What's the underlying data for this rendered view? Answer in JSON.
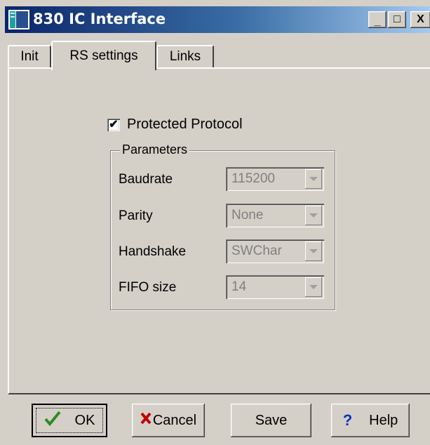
{
  "window": {
    "title": "830 IC Interface",
    "icon": "app-window-icon",
    "controls": {
      "minimize": "_",
      "maximize": "□",
      "close": "X"
    }
  },
  "tabs": [
    {
      "label": "Init",
      "active": false
    },
    {
      "label": "RS settings",
      "active": true
    },
    {
      "label": "Links",
      "active": false
    }
  ],
  "protected_protocol": {
    "label": "Protected Protocol",
    "checked": true,
    "mark": "✔"
  },
  "parameters": {
    "title": "Parameters",
    "fields": [
      {
        "label": "Baudrate",
        "value": "115200"
      },
      {
        "label": "Parity",
        "value": "None"
      },
      {
        "label": "Handshake",
        "value": "SWChar"
      },
      {
        "label": "FIFO size",
        "value": "14"
      }
    ]
  },
  "buttons": {
    "ok": "OK",
    "cancel": "Cancel",
    "save": "Save",
    "help": "Help"
  },
  "colors": {
    "title_start": "#0a246a",
    "title_end": "#a6caf0",
    "face": "#d4d0c8",
    "ok_check": "#2e8b22",
    "cancel_x": "#c00000",
    "help_q": "#1030c0"
  }
}
